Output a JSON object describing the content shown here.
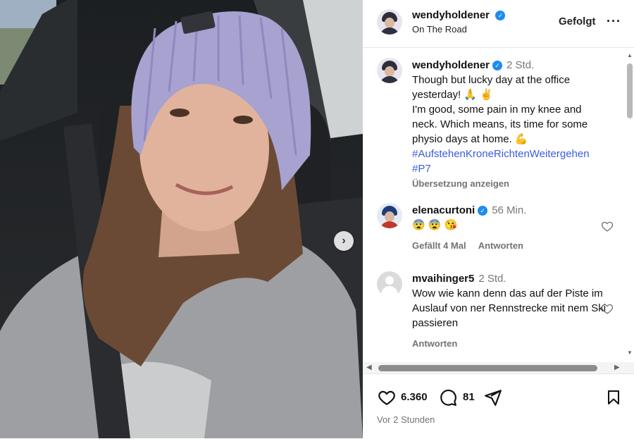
{
  "post": {
    "username": "wendyholdener",
    "location": "On The Road",
    "follow_label": "Gefolgt",
    "more_label": "···"
  },
  "caption": {
    "username": "wendyholdener",
    "time": "2 Std.",
    "line1": "Though but lucky day at the office yesterday! 🙏 ✌",
    "line2": "I'm good, some pain in my knee and neck. Which means, its time for some physio days at home. 💪",
    "hashtags": "#AufstehenKroneRichtenWeitergehen #P7",
    "translate_label": "Übersetzung anzeigen"
  },
  "comments": [
    {
      "username": "elenacurtoni",
      "time": "56 Min.",
      "text": "😨 😨 😘",
      "likes_label": "Gefällt 4 Mal",
      "reply_label": "Antworten"
    },
    {
      "username": "mvaihinger5",
      "time": "2 Std.",
      "text": "Wow wie kann denn das auf der Piste im Auslauf von ner Rennstrecke mit nem Ski passieren",
      "reply_label": "Antworten"
    }
  ],
  "actions": {
    "likes": "6.360",
    "comments": "81",
    "date": "Vor 2 Stunden"
  },
  "icons": {
    "next": "chevron-right-icon",
    "verified": "verified-badge-icon",
    "heart": "heart-icon",
    "comment": "comment-icon",
    "share": "share-icon",
    "save": "bookmark-icon"
  },
  "colors": {
    "verified": "#1d8cf0",
    "hashtag": "#3b5bdb",
    "beanie": "#a7a2cf",
    "sweater": "#9e9fa3"
  }
}
